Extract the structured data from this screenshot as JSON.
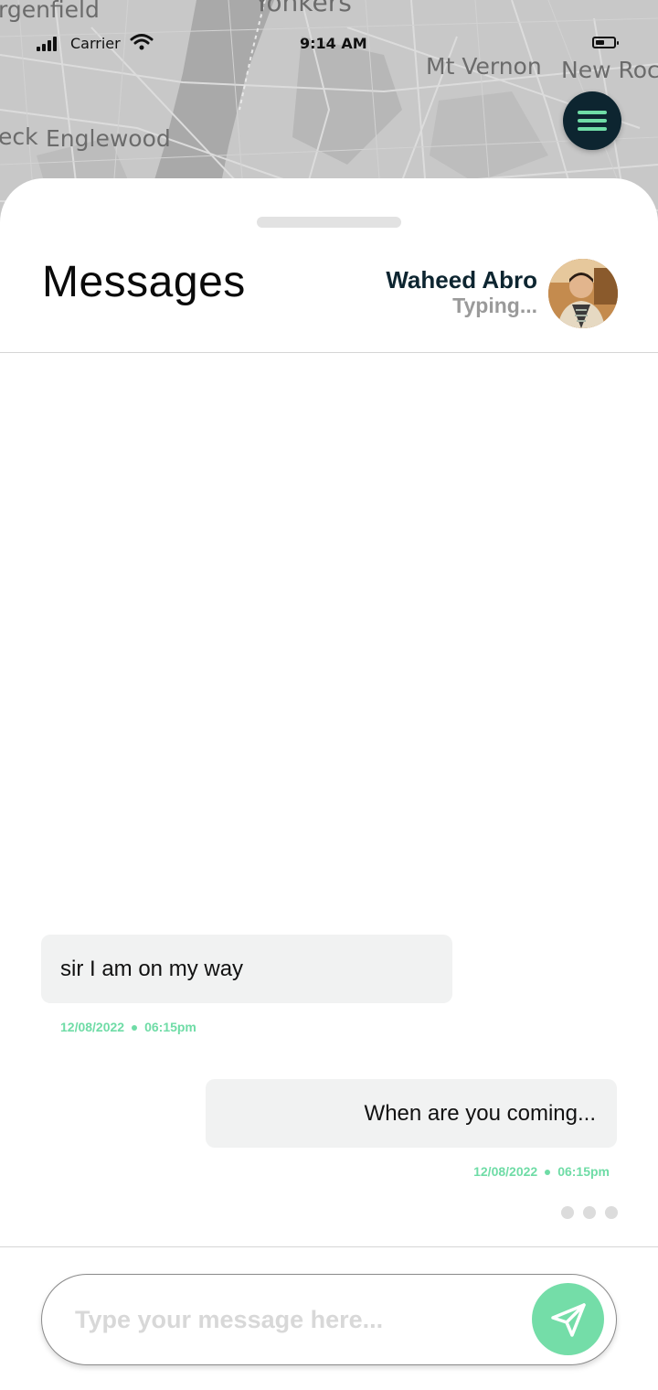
{
  "map": {
    "labels": [
      "rgenfield",
      "Yonkers",
      "Mt Vernon",
      "New Roch",
      "eck",
      "Englewood"
    ]
  },
  "status_bar": {
    "carrier": "Carrier",
    "time": "9:14 AM"
  },
  "menu_button": {
    "icon": "hamburger-menu-icon"
  },
  "header": {
    "title": "Messages",
    "contact_name": "Waheed Abro",
    "contact_status": "Typing..."
  },
  "messages": [
    {
      "direction": "incoming",
      "text": "sir I am on my way",
      "date": "12/08/2022",
      "time": "06:15pm"
    },
    {
      "direction": "outgoing",
      "text": "When are you coming...",
      "date": "12/08/2022",
      "time": "06:15pm"
    }
  ],
  "composer": {
    "placeholder": "Type your message here...",
    "value": "",
    "send_icon": "paper-plane-icon"
  },
  "colors": {
    "accent": "#74dda8",
    "dark": "#0d2530",
    "bubble": "#f1f2f2"
  }
}
